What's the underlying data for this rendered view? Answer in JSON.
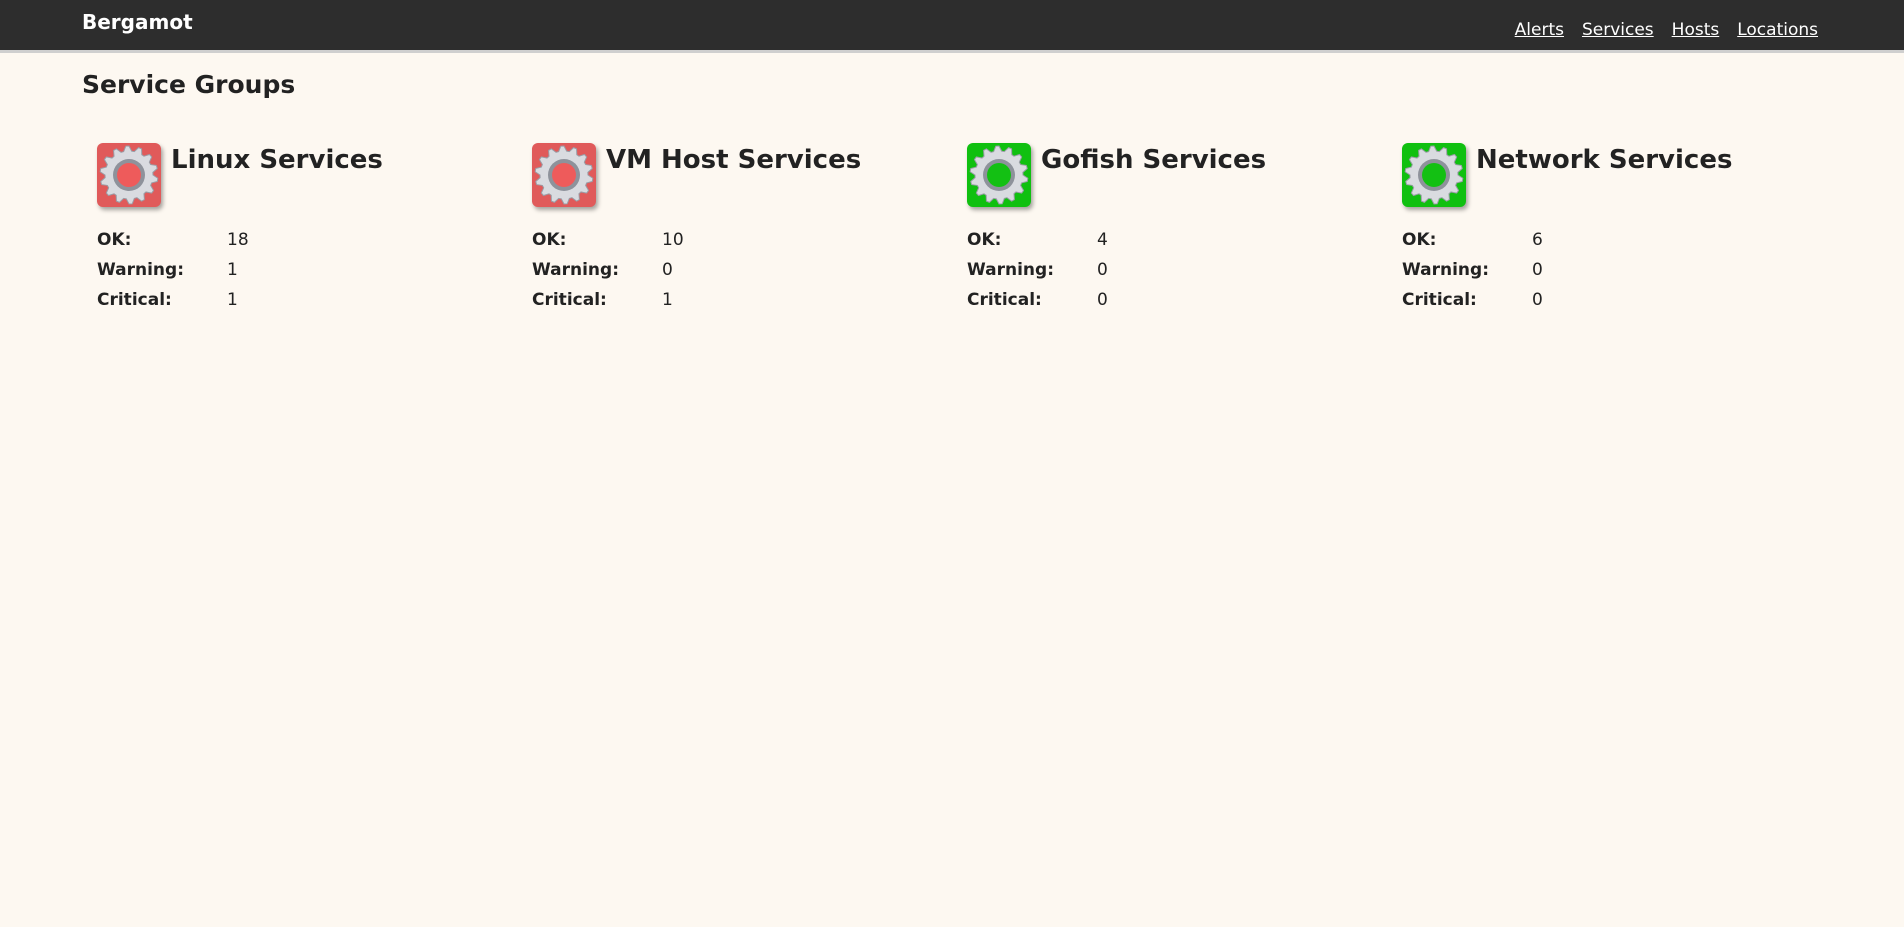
{
  "header": {
    "brand": "Bergamot",
    "nav": [
      {
        "label": "Alerts"
      },
      {
        "label": "Services"
      },
      {
        "label": "Hosts"
      },
      {
        "label": "Locations"
      }
    ]
  },
  "page": {
    "title": "Service Groups"
  },
  "groups": [
    {
      "name": "Linux Services",
      "status": "critical",
      "status_color": "#e05a5a",
      "dot_color": "#ee5b5b",
      "icon": "gear-status-icon",
      "ok_label": "OK:",
      "ok": "18",
      "warning_label": "Warning:",
      "warning": "1",
      "critical_label": "Critical:",
      "critical": "1"
    },
    {
      "name": "VM Host Services",
      "status": "critical",
      "status_color": "#e05a5a",
      "dot_color": "#ee5b5b",
      "icon": "gear-status-icon",
      "ok_label": "OK:",
      "ok": "10",
      "warning_label": "Warning:",
      "warning": "0",
      "critical_label": "Critical:",
      "critical": "1"
    },
    {
      "name": "Gofish Services",
      "status": "ok",
      "status_color": "#10c010",
      "dot_color": "#13c013",
      "icon": "gear-status-icon",
      "ok_label": "OK:",
      "ok": "4",
      "warning_label": "Warning:",
      "warning": "0",
      "critical_label": "Critical:",
      "critical": "0"
    },
    {
      "name": "Network Services",
      "status": "ok",
      "status_color": "#10c010",
      "dot_color": "#13c013",
      "icon": "gear-status-icon",
      "ok_label": "OK:",
      "ok": "6",
      "warning_label": "Warning:",
      "warning": "0",
      "critical_label": "Critical:",
      "critical": "0"
    }
  ]
}
